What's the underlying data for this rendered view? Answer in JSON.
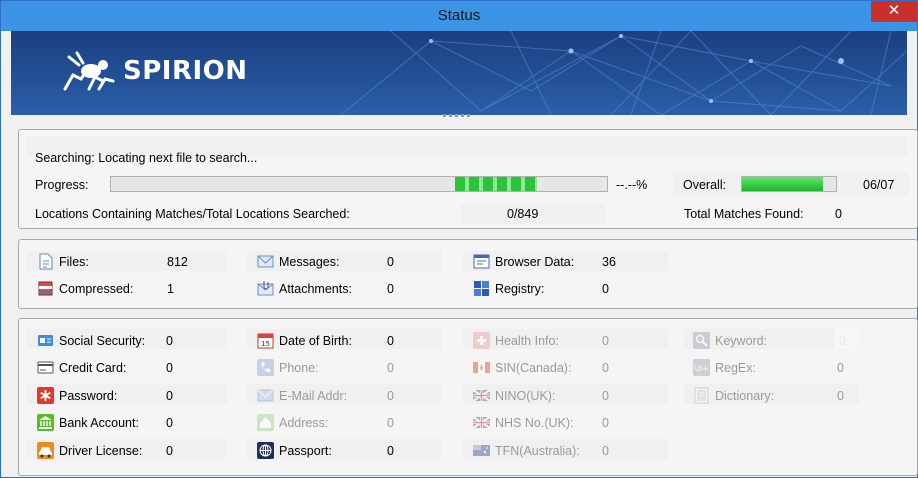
{
  "window": {
    "title": "Status",
    "close_glyph": "✕"
  },
  "brand": {
    "name": "SPIRION",
    "logo_icon": "spirion-bug-icon"
  },
  "status": {
    "searching_text": "Searching: Locating next file to search...",
    "progress_label": "Progress:",
    "progress_value": "--.--%",
    "overall_label": "Overall:",
    "overall_value": "06/07",
    "overall_fraction": 0.86,
    "locations_label": "Locations Containing Matches/Total Locations Searched:",
    "locations_value": "0/849",
    "total_matches_label": "Total Matches Found:",
    "total_matches_value": "0"
  },
  "locations": [
    {
      "label": "Files:",
      "value": "812",
      "icon": "file-icon"
    },
    {
      "label": "Compressed:",
      "value": "1",
      "icon": "archive-icon"
    },
    {
      "label": "Messages:",
      "value": "0",
      "icon": "envelope-icon"
    },
    {
      "label": "Attachments:",
      "value": "0",
      "icon": "attachment-icon"
    },
    {
      "label": "Browser Data:",
      "value": "36",
      "icon": "browser-icon"
    },
    {
      "label": "Registry:",
      "value": "0",
      "icon": "registry-icon"
    }
  ],
  "types": [
    {
      "label": "Social Security:",
      "value": "0",
      "icon": "id-card-icon",
      "enabled": true
    },
    {
      "label": "Credit Card:",
      "value": "0",
      "icon": "credit-card-icon",
      "enabled": true
    },
    {
      "label": "Password:",
      "value": "0",
      "icon": "asterisk-icon",
      "enabled": true
    },
    {
      "label": "Bank Account:",
      "value": "0",
      "icon": "bank-icon",
      "enabled": true
    },
    {
      "label": "Driver License:",
      "value": "0",
      "icon": "car-icon",
      "enabled": true
    },
    {
      "label": "Date of Birth:",
      "value": "0",
      "icon": "calendar-icon",
      "enabled": true
    },
    {
      "label": "Phone:",
      "value": "0",
      "icon": "phone-icon",
      "enabled": false
    },
    {
      "label": "E-Mail Addr:",
      "value": "0",
      "icon": "email-icon",
      "enabled": false
    },
    {
      "label": "Address:",
      "value": "0",
      "icon": "home-icon",
      "enabled": false
    },
    {
      "label": "Passport:",
      "value": "0",
      "icon": "globe-icon",
      "enabled": true
    },
    {
      "label": "Health Info:",
      "value": "0",
      "icon": "health-icon",
      "enabled": false
    },
    {
      "label": "SIN(Canada):",
      "value": "0",
      "icon": "canada-flag-icon",
      "enabled": false
    },
    {
      "label": "NINO(UK):",
      "value": "0",
      "icon": "uk-flag-icon",
      "enabled": false
    },
    {
      "label": "NHS No.(UK):",
      "value": "0",
      "icon": "uk-flag-icon",
      "enabled": false
    },
    {
      "label": "TFN(Australia):",
      "value": "0",
      "icon": "australia-flag-icon",
      "enabled": false
    },
    {
      "label": "Keyword:",
      "value": "0",
      "icon": "magnifier-icon",
      "enabled": false
    },
    {
      "label": "RegEx:",
      "value": "0",
      "icon": "regex-icon",
      "enabled": false
    },
    {
      "label": "Dictionary:",
      "value": "0",
      "icon": "dictionary-icon",
      "enabled": false
    }
  ]
}
